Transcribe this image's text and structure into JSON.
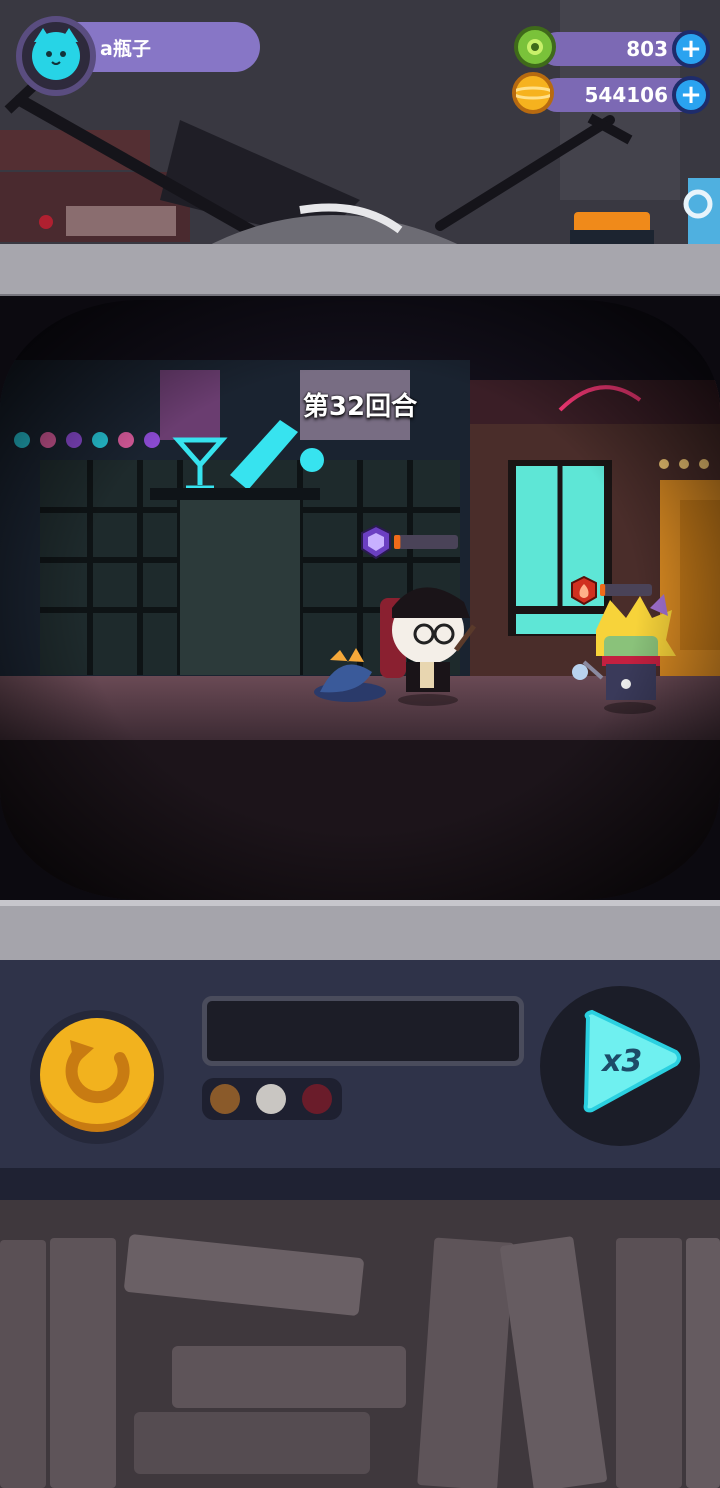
{
  "player": {
    "name": "a瓶子",
    "avatar_icon": "cat-face-icon"
  },
  "currencies": [
    {
      "name": "gem",
      "icon": "green-gem-icon",
      "value": "803"
    },
    {
      "name": "coin",
      "icon": "planet-coin-icon",
      "value": "544106"
    }
  ],
  "battle": {
    "round_text": "第32回合",
    "player_hero": {
      "badge_icon": "shield-icon",
      "hp_fraction": 0.1
    },
    "enemy": {
      "badge_icon": "fire-icon",
      "hp_fraction": 0.1
    }
  },
  "controls": {
    "reset_icon": "restart-icon",
    "speed_label": "x3",
    "speed_icon": "play-icon"
  },
  "colors": {
    "accent_cyan": "#27d4e6",
    "coin_gold": "#f2b21e",
    "pill_purple": "#8776c6",
    "plus_blue": "#2aa3f0"
  }
}
